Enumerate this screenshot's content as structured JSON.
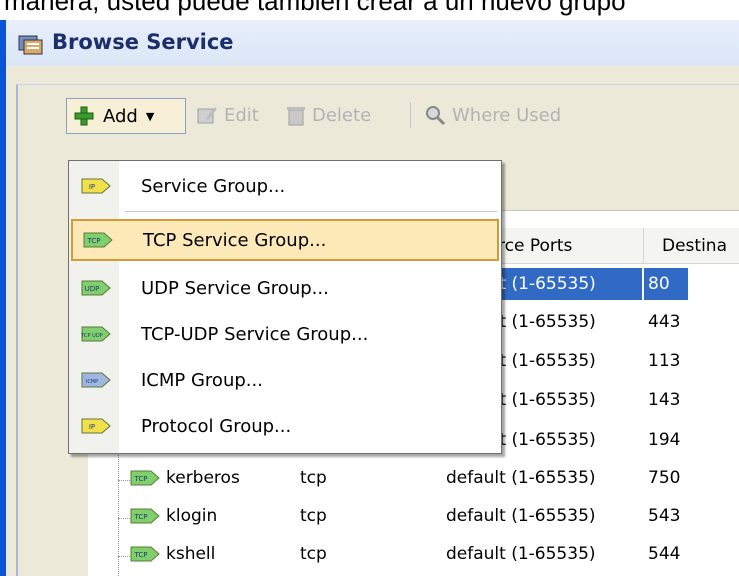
{
  "caption": "manera, usted puede también crear a un nuevo grupo",
  "window": {
    "title": "Browse Service"
  },
  "toolbar": {
    "add_label": "Add",
    "edit_label": "Edit",
    "delete_label": "Delete",
    "where_used_label": "Where Used"
  },
  "menu": {
    "items": [
      {
        "label": "Service Group...",
        "badge": "IP"
      },
      {
        "label": "TCP Service Group...",
        "badge": "TCP"
      },
      {
        "label": "UDP Service Group...",
        "badge": "UDP"
      },
      {
        "label": "TCP-UDP Service Group...",
        "badge": "TCP UDP"
      },
      {
        "label": "ICMP Group...",
        "badge": "ICMP"
      },
      {
        "label": "Protocol Group...",
        "badge": "IP"
      }
    ]
  },
  "table": {
    "columns": [
      "rce Ports",
      "Destina"
    ],
    "rows": [
      {
        "name": "",
        "protocol": "",
        "source_ports": "ılt (1-65535)",
        "dest": "80",
        "selected": true
      },
      {
        "name": "",
        "protocol": "",
        "source_ports": "ılt (1-65535)",
        "dest": "443"
      },
      {
        "name": "",
        "protocol": "",
        "source_ports": "ılt (1-65535)",
        "dest": "113"
      },
      {
        "name": "",
        "protocol": "",
        "source_ports": "ılt (1-65535)",
        "dest": "143"
      },
      {
        "name": "",
        "protocol": "",
        "source_ports": "ılt (1-65535)",
        "dest": "194"
      },
      {
        "name": "kerberos",
        "protocol": "tcp",
        "source_ports": "default (1-65535)",
        "dest": "750"
      },
      {
        "name": "klogin",
        "protocol": "tcp",
        "source_ports": "default (1-65535)",
        "dest": "543"
      },
      {
        "name": "kshell",
        "protocol": "tcp",
        "source_ports": "default (1-65535)",
        "dest": "544"
      }
    ],
    "row_badge": "TCP"
  },
  "colors": {
    "selection": "#316ac5",
    "menu_highlight": "#fde9b8",
    "menu_highlight_border": "#d49a33"
  }
}
